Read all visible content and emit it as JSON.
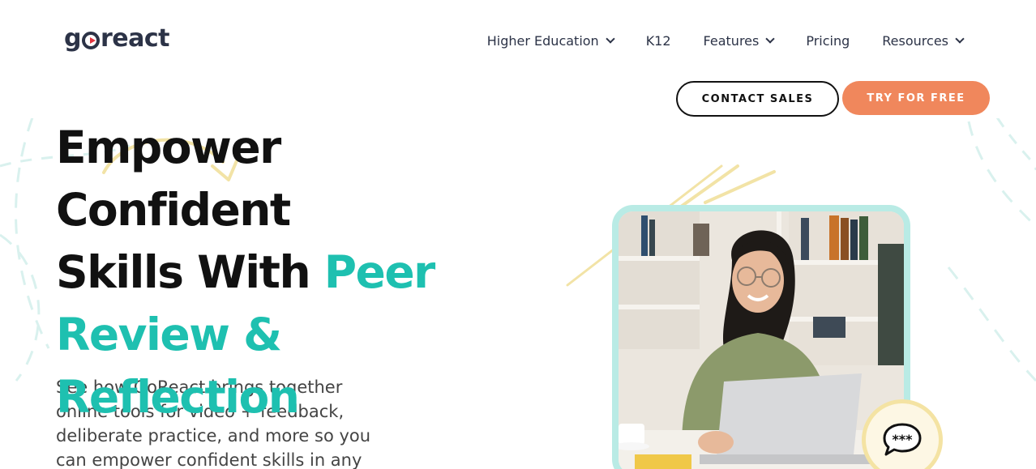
{
  "logo": {
    "text_before": "g",
    "text_after": "react"
  },
  "nav": {
    "items": [
      {
        "label": "Higher Education",
        "dropdown": true
      },
      {
        "label": "K12",
        "dropdown": false
      },
      {
        "label": "Features",
        "dropdown": true
      },
      {
        "label": "Pricing",
        "dropdown": false
      },
      {
        "label": "Resources",
        "dropdown": true
      }
    ],
    "contact_label": "CONTACT SALES",
    "try_label": "TRY FOR FREE"
  },
  "hero": {
    "title_line1": "Empower",
    "title_line2": "Confident",
    "title_line3_plain": "Skills With ",
    "title_line3_accent": "Peer",
    "title_line4": "Review &",
    "title_line5": "Reflection",
    "subtitle": "See how GoReact brings together online tools for video + feedback, deliberate practice, and more so you can empower confident skills in any"
  },
  "colors": {
    "accent": "#1ec0b0",
    "cta": "#f0875c",
    "text_dark": "#2c3347",
    "frame": "#b9ebe5",
    "squiggle": "#f2e3a6"
  },
  "icons": {
    "logo_mark": "play-circle-icon",
    "chat": "chat-bubble-icon",
    "chevron": "chevron-down-icon"
  }
}
